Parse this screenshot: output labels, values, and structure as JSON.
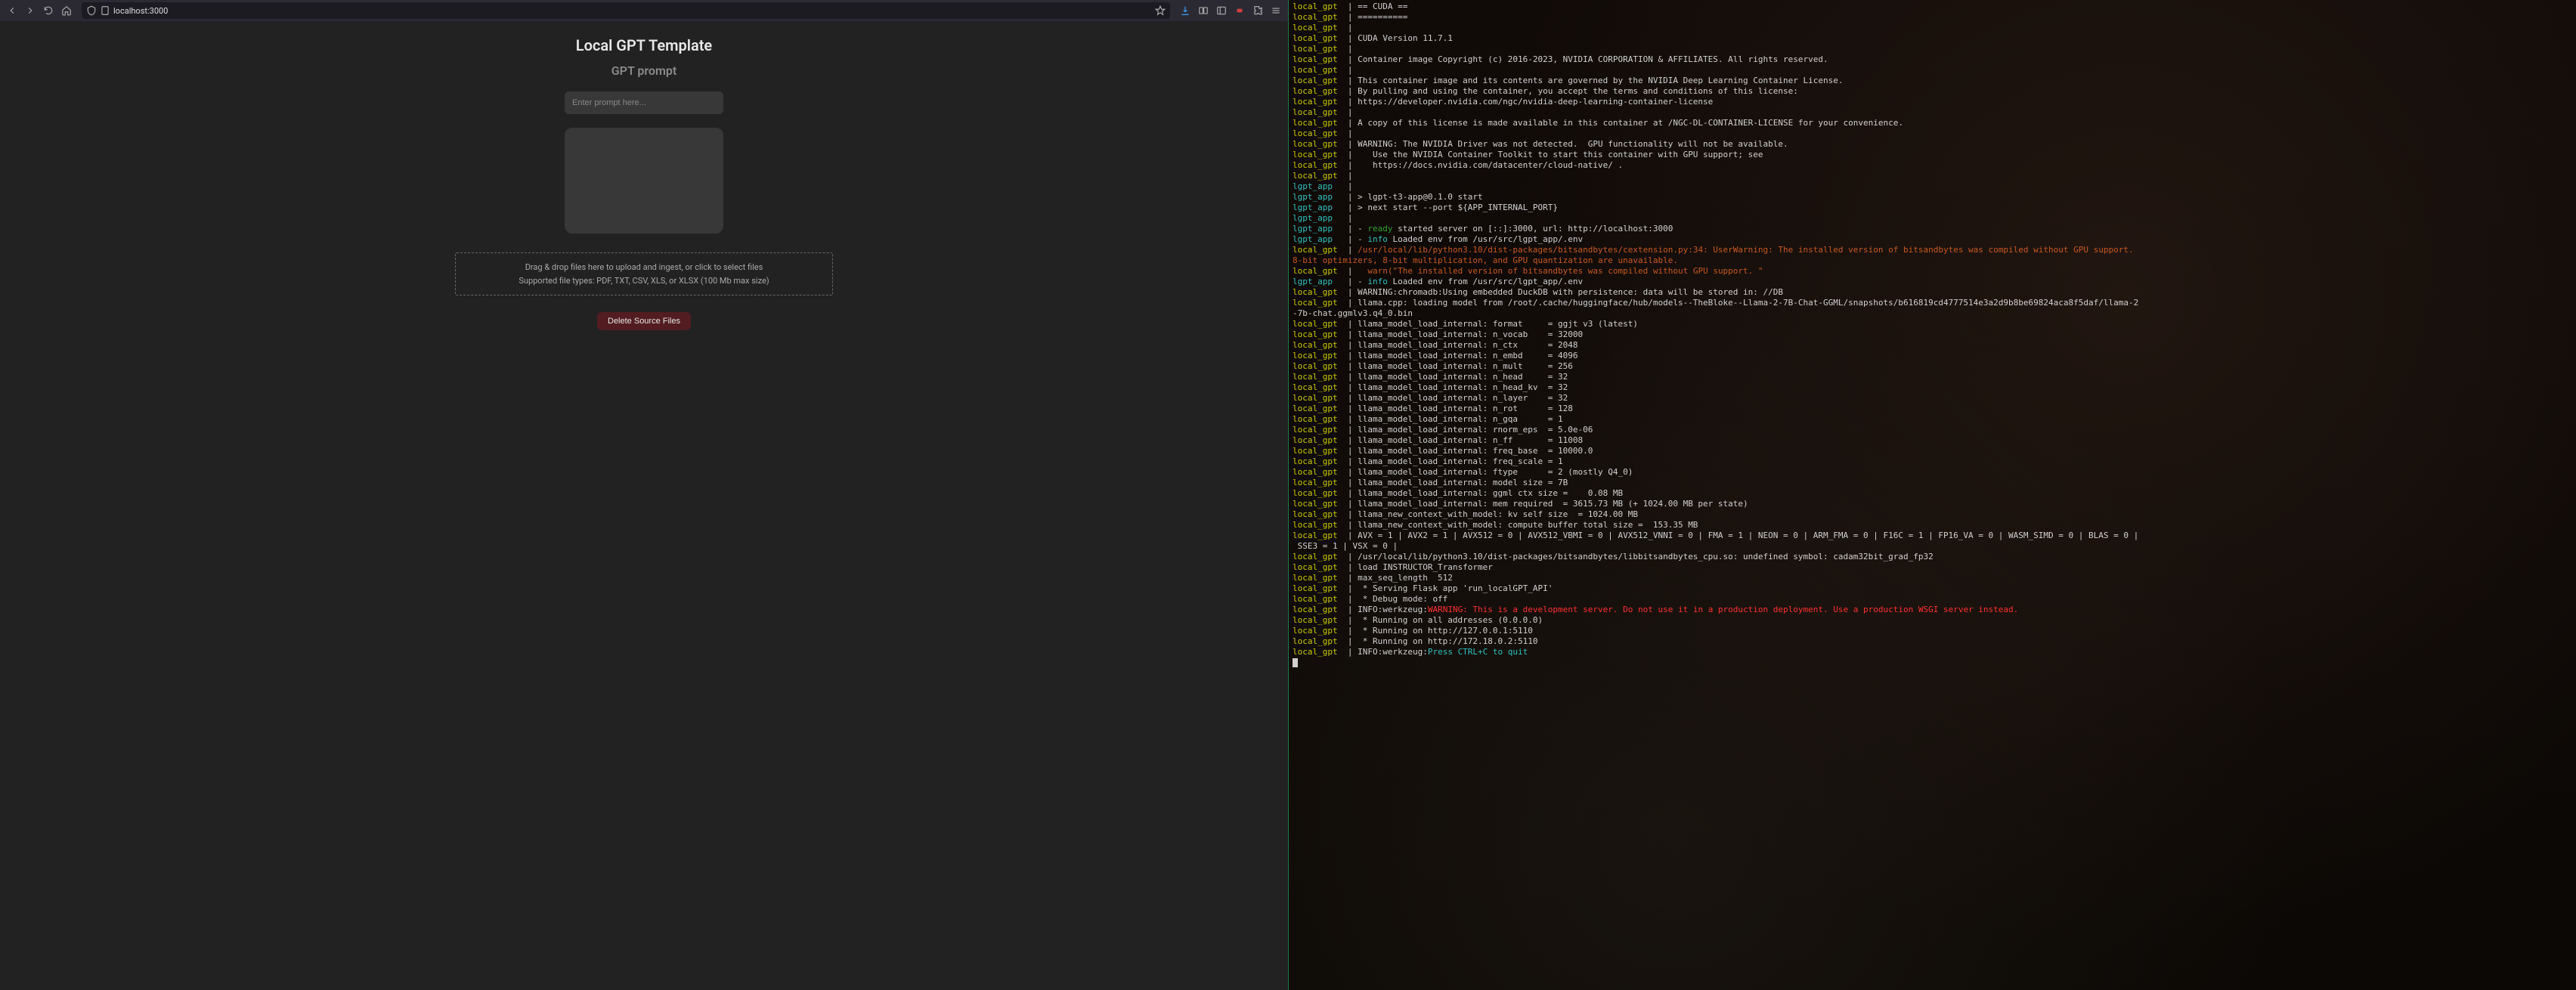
{
  "browser": {
    "url": "localhost:3000",
    "page_title": "Local GPT Template",
    "subtitle": "GPT prompt",
    "prompt_placeholder": "Enter prompt here...",
    "dropzone_line1": "Drag & drop files here to upload and ingest, or click to select files",
    "dropzone_line2": "Supported file types: PDF, TXT, CSV, XLS, or XLSX (100 Mb max size)",
    "delete_btn": "Delete Source Files"
  },
  "terminal": {
    "lines": [
      {
        "prefix": "local_gpt",
        "pc": "y",
        "text": "  | == CUDA =="
      },
      {
        "prefix": "local_gpt",
        "pc": "y",
        "text": "  | =========="
      },
      {
        "prefix": "local_gpt",
        "pc": "y",
        "text": "  |"
      },
      {
        "prefix": "local_gpt",
        "pc": "y",
        "text": "  | CUDA Version 11.7.1"
      },
      {
        "prefix": "local_gpt",
        "pc": "y",
        "text": "  |"
      },
      {
        "prefix": "local_gpt",
        "pc": "y",
        "text": "  | Container image Copyright (c) 2016-2023, NVIDIA CORPORATION & AFFILIATES. All rights reserved."
      },
      {
        "prefix": "local_gpt",
        "pc": "y",
        "text": "  |"
      },
      {
        "prefix": "local_gpt",
        "pc": "y",
        "text": "  | This container image and its contents are governed by the NVIDIA Deep Learning Container License."
      },
      {
        "prefix": "local_gpt",
        "pc": "y",
        "text": "  | By pulling and using the container, you accept the terms and conditions of this license:"
      },
      {
        "prefix": "local_gpt",
        "pc": "y",
        "text": "  | https://developer.nvidia.com/ngc/nvidia-deep-learning-container-license"
      },
      {
        "prefix": "local_gpt",
        "pc": "y",
        "text": "  |"
      },
      {
        "prefix": "local_gpt",
        "pc": "y",
        "text": "  | A copy of this license is made available in this container at /NGC-DL-CONTAINER-LICENSE for your convenience."
      },
      {
        "prefix": "local_gpt",
        "pc": "y",
        "text": "  |"
      },
      {
        "prefix": "local_gpt",
        "pc": "y",
        "text": "  | WARNING: The NVIDIA Driver was not detected.  GPU functionality will not be available."
      },
      {
        "prefix": "local_gpt",
        "pc": "y",
        "text": "  |    Use the NVIDIA Container Toolkit to start this container with GPU support; see"
      },
      {
        "prefix": "local_gpt",
        "pc": "y",
        "text": "  |    https://docs.nvidia.com/datacenter/cloud-native/ ."
      },
      {
        "prefix": "local_gpt",
        "pc": "y",
        "text": "  |"
      },
      {
        "prefix": "lgpt_app",
        "pc": "c",
        "text": "   |"
      },
      {
        "prefix": "lgpt_app",
        "pc": "c",
        "text": "   | > lgpt-t3-app@0.1.0 start"
      },
      {
        "prefix": "lgpt_app",
        "pc": "c",
        "text": "   | > next start --port ${APP_INTERNAL_PORT}"
      },
      {
        "prefix": "lgpt_app",
        "pc": "c",
        "text": "   |"
      },
      {
        "prefix": "lgpt_app",
        "pc": "c",
        "segments": [
          {
            "t": "   | - ",
            "c": "txt"
          },
          {
            "t": "ready",
            "c": "grn"
          },
          {
            "t": " started server on [::]:3000, url: http://localhost:3000",
            "c": "txt"
          }
        ]
      },
      {
        "prefix": "lgpt_app",
        "pc": "c",
        "segments": [
          {
            "t": "   | - ",
            "c": "txt"
          },
          {
            "t": "info",
            "c": "cyan"
          },
          {
            "t": " Loaded env from /usr/src/lgpt_app/.env",
            "c": "txt"
          }
        ]
      },
      {
        "prefix": "local_gpt",
        "pc": "y",
        "segments": [
          {
            "t": "  | ",
            "c": "txt"
          },
          {
            "t": "/usr/local/lib/python3.10/dist-packages/bitsandbytes/cextension.py:34: UserWarning: The installed version of bitsandbytes was compiled without GPU support.",
            "c": "warn"
          }
        ]
      },
      {
        "prefix": "",
        "pc": "",
        "segments": [
          {
            "t": "8-bit optimizers, 8-bit multiplication, and GPU quantization are unavailable.",
            "c": "warn"
          }
        ]
      },
      {
        "prefix": "local_gpt",
        "pc": "y",
        "segments": [
          {
            "t": "  |   ",
            "c": "txt"
          },
          {
            "t": "warn(\"The installed version of bitsandbytes was compiled without GPU support. \"",
            "c": "warn"
          }
        ]
      },
      {
        "prefix": "lgpt_app",
        "pc": "c",
        "segments": [
          {
            "t": "   | - ",
            "c": "txt"
          },
          {
            "t": "info",
            "c": "cyan"
          },
          {
            "t": " Loaded env from /usr/src/lgpt_app/.env",
            "c": "txt"
          }
        ]
      },
      {
        "prefix": "local_gpt",
        "pc": "y",
        "text": "  | WARNING:chromadb:Using embedded DuckDB with persistence: data will be stored in: //DB"
      },
      {
        "prefix": "local_gpt",
        "pc": "y",
        "text": "  | llama.cpp: loading model from /root/.cache/huggingface/hub/models--TheBloke--Llama-2-7B-Chat-GGML/snapshots/b616819cd4777514e3a2d9b8be69824aca8f5daf/llama-2"
      },
      {
        "prefix": "",
        "pc": "",
        "text": "-7b-chat.ggmlv3.q4_0.bin"
      },
      {
        "prefix": "local_gpt",
        "pc": "y",
        "text": "  | llama_model_load_internal: format     = ggjt v3 (latest)"
      },
      {
        "prefix": "local_gpt",
        "pc": "y",
        "text": "  | llama_model_load_internal: n_vocab    = 32000"
      },
      {
        "prefix": "local_gpt",
        "pc": "y",
        "text": "  | llama_model_load_internal: n_ctx      = 2048"
      },
      {
        "prefix": "local_gpt",
        "pc": "y",
        "text": "  | llama_model_load_internal: n_embd     = 4096"
      },
      {
        "prefix": "local_gpt",
        "pc": "y",
        "text": "  | llama_model_load_internal: n_mult     = 256"
      },
      {
        "prefix": "local_gpt",
        "pc": "y",
        "text": "  | llama_model_load_internal: n_head     = 32"
      },
      {
        "prefix": "local_gpt",
        "pc": "y",
        "text": "  | llama_model_load_internal: n_head_kv  = 32"
      },
      {
        "prefix": "local_gpt",
        "pc": "y",
        "text": "  | llama_model_load_internal: n_layer    = 32"
      },
      {
        "prefix": "local_gpt",
        "pc": "y",
        "text": "  | llama_model_load_internal: n_rot      = 128"
      },
      {
        "prefix": "local_gpt",
        "pc": "y",
        "text": "  | llama_model_load_internal: n_gqa      = 1"
      },
      {
        "prefix": "local_gpt",
        "pc": "y",
        "text": "  | llama_model_load_internal: rnorm_eps  = 5.0e-06"
      },
      {
        "prefix": "local_gpt",
        "pc": "y",
        "text": "  | llama_model_load_internal: n_ff       = 11008"
      },
      {
        "prefix": "local_gpt",
        "pc": "y",
        "text": "  | llama_model_load_internal: freq_base  = 10000.0"
      },
      {
        "prefix": "local_gpt",
        "pc": "y",
        "text": "  | llama_model_load_internal: freq_scale = 1"
      },
      {
        "prefix": "local_gpt",
        "pc": "y",
        "text": "  | llama_model_load_internal: ftype      = 2 (mostly Q4_0)"
      },
      {
        "prefix": "local_gpt",
        "pc": "y",
        "text": "  | llama_model_load_internal: model size = 7B"
      },
      {
        "prefix": "local_gpt",
        "pc": "y",
        "text": "  | llama_model_load_internal: ggml ctx size =    0.08 MB"
      },
      {
        "prefix": "local_gpt",
        "pc": "y",
        "text": "  | llama_model_load_internal: mem required  = 3615.73 MB (+ 1024.00 MB per state)"
      },
      {
        "prefix": "local_gpt",
        "pc": "y",
        "text": "  | llama_new_context_with_model: kv self size  = 1024.00 MB"
      },
      {
        "prefix": "local_gpt",
        "pc": "y",
        "text": "  | llama_new_context_with_model: compute buffer total size =  153.35 MB"
      },
      {
        "prefix": "local_gpt",
        "pc": "y",
        "text": "  | AVX = 1 | AVX2 = 1 | AVX512 = 0 | AVX512_VBMI = 0 | AVX512_VNNI = 0 | FMA = 1 | NEON = 0 | ARM_FMA = 0 | F16C = 1 | FP16_VA = 0 | WASM_SIMD = 0 | BLAS = 0 |"
      },
      {
        "prefix": "",
        "pc": "",
        "text": " SSE3 = 1 | VSX = 0 |"
      },
      {
        "prefix": "local_gpt",
        "pc": "y",
        "text": "  | /usr/local/lib/python3.10/dist-packages/bitsandbytes/libbitsandbytes_cpu.so: undefined symbol: cadam32bit_grad_fp32"
      },
      {
        "prefix": "local_gpt",
        "pc": "y",
        "text": "  | load INSTRUCTOR_Transformer"
      },
      {
        "prefix": "local_gpt",
        "pc": "y",
        "text": "  | max_seq_length  512"
      },
      {
        "prefix": "local_gpt",
        "pc": "y",
        "text": "  |  * Serving Flask app 'run_localGPT_API'"
      },
      {
        "prefix": "local_gpt",
        "pc": "y",
        "text": "  |  * Debug mode: off"
      },
      {
        "prefix": "local_gpt",
        "pc": "y",
        "segments": [
          {
            "t": "  | INFO:werkzeug:",
            "c": "txt"
          },
          {
            "t": "WARNING: This is a development server. Do not use it in a production deployment. Use a production WSGI server instead.",
            "c": "red"
          }
        ]
      },
      {
        "prefix": "local_gpt",
        "pc": "y",
        "text": "  |  * Running on all addresses (0.0.0.0)"
      },
      {
        "prefix": "local_gpt",
        "pc": "y",
        "text": "  |  * Running on http://127.0.0.1:5110"
      },
      {
        "prefix": "local_gpt",
        "pc": "y",
        "text": "  |  * Running on http://172.18.0.2:5110"
      },
      {
        "prefix": "local_gpt",
        "pc": "y",
        "segments": [
          {
            "t": "  | INFO:werkzeug:",
            "c": "txt"
          },
          {
            "t": "Press CTRL+C to quit",
            "c": "cyan"
          }
        ]
      }
    ]
  }
}
